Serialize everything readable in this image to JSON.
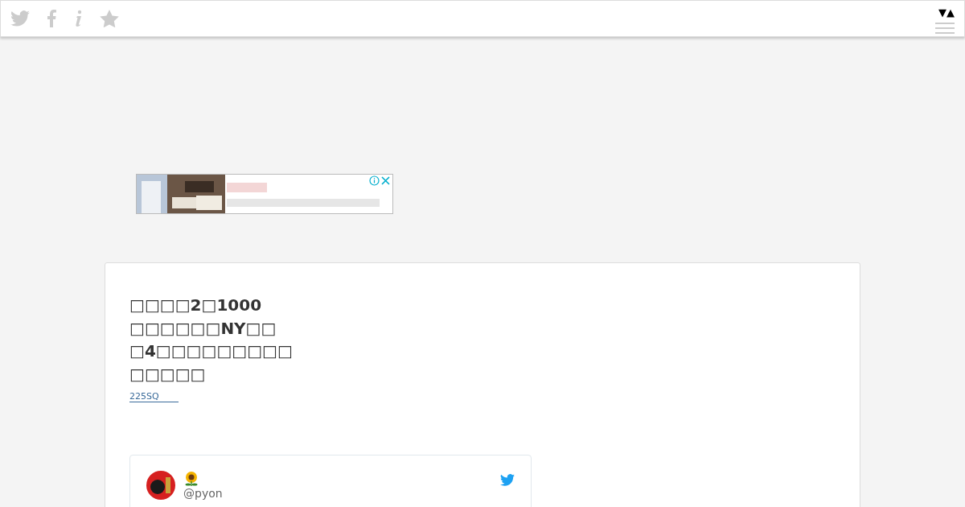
{
  "toolbar": {
    "icons": [
      {
        "kind": "twitter"
      },
      {
        "kind": "facebook"
      },
      {
        "kind": "info"
      },
      {
        "kind": "star"
      }
    ],
    "toggle": "▼▲"
  },
  "article": {
    "title_lines": [
      "□□□□2□1000",
      "□□□□□□NY□□",
      "□4□□□□□□□□□",
      "□□□□□"
    ],
    "source_link": "225SQ"
  },
  "tweet": {
    "handle": "@pyon"
  }
}
